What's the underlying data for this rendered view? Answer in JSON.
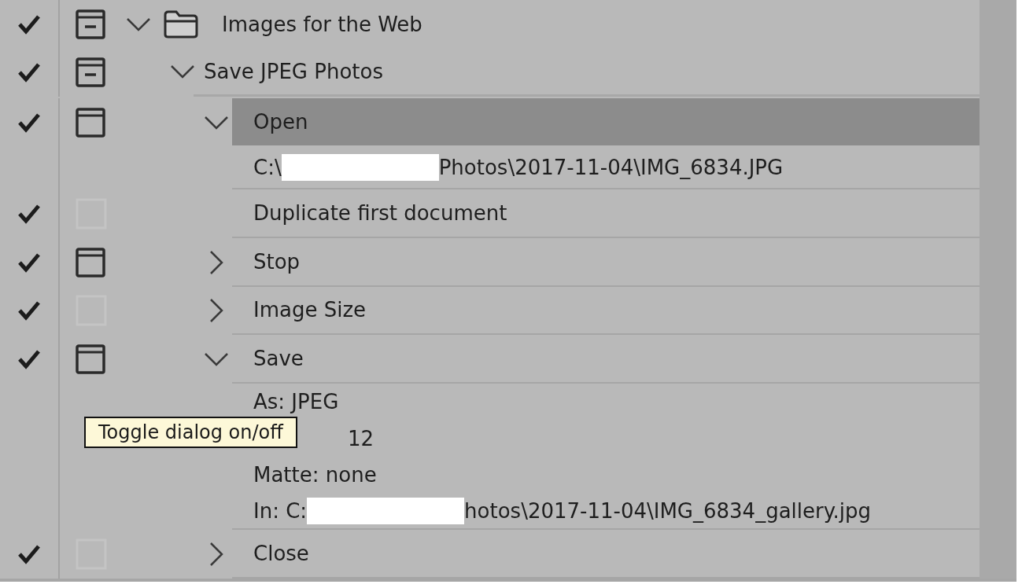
{
  "actions": [
    {
      "label": "Images for the Web",
      "kind": "set",
      "enabled": true,
      "dialog": true,
      "partial": true,
      "expanded": true,
      "children": [
        {
          "label": "Save JPEG Photos",
          "kind": "action",
          "enabled": true,
          "dialog": true,
          "partial": true,
          "expanded": true,
          "children": [
            {
              "label": "Open",
              "kind": "step",
              "enabled": true,
              "dialog": true,
              "expanded": true,
              "selected": true,
              "details": [
                {
                  "segments": [
                    {
                      "kind": "text",
                      "text": "C:\\"
                    },
                    {
                      "kind": "redacted"
                    },
                    {
                      "kind": "text",
                      "text": "Photos\\2017-11-04\\IMG_6834.JPG"
                    }
                  ]
                }
              ]
            },
            {
              "label": "Duplicate first document",
              "kind": "leaf",
              "enabled": true,
              "dialog": false,
              "selected": false
            },
            {
              "label": "Stop",
              "kind": "step",
              "enabled": true,
              "dialog": true,
              "expanded": false,
              "selected": false
            },
            {
              "label": "Image Size",
              "kind": "step",
              "enabled": true,
              "dialog": false,
              "expanded": false,
              "selected": false
            },
            {
              "label": "Save",
              "kind": "step",
              "enabled": true,
              "dialog": true,
              "expanded": true,
              "selected": false,
              "details": [
                {
                  "segments": [
                    {
                      "kind": "text",
                      "text": "As: JPEG"
                    }
                  ]
                },
                {
                  "segments": [
                    {
                      "kind": "covered"
                    },
                    {
                      "kind": "text",
                      "text": "12"
                    }
                  ]
                },
                {
                  "segments": [
                    {
                      "kind": "text",
                      "text": "Matte: none"
                    }
                  ]
                },
                {
                  "segments": [
                    {
                      "kind": "text",
                      "text": "In: C:"
                    },
                    {
                      "kind": "redacted"
                    },
                    {
                      "kind": "text",
                      "text": "hotos\\2017-11-04\\IMG_6834_gallery.jpg"
                    }
                  ]
                }
              ]
            },
            {
              "label": "Close",
              "kind": "step",
              "enabled": true,
              "dialog": false,
              "expanded": false,
              "selected": false
            }
          ]
        }
      ]
    }
  ],
  "tooltip": {
    "text": "Toggle dialog on/off"
  }
}
